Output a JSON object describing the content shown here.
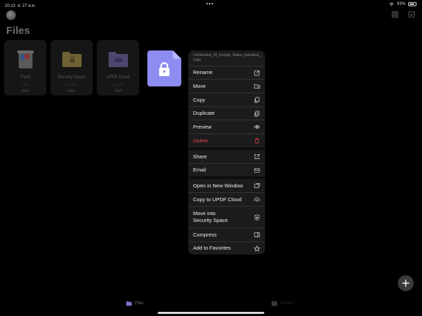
{
  "status_bar": {
    "time": "20:13",
    "date": "ส. 27 ส.ค.",
    "battery": "83%",
    "battery_level": 0.83
  },
  "page_title": "Files",
  "tiles": [
    {
      "name": "Trash",
      "sub": "1 Item",
      "badge": ""
    },
    {
      "name": "Security Space",
      "sub": "12 Items",
      "badge": ""
    },
    {
      "name": "UPDF Cloud",
      "sub": "0 Items",
      "badge": ""
    }
  ],
  "context_menu": {
    "file_name": "Certification_Of_Foreign_Status_Individual_Copy",
    "items": [
      {
        "label": "Rename",
        "icon": "rename-icon"
      },
      {
        "label": "Move",
        "icon": "folder-move-icon"
      },
      {
        "label": "Copy",
        "icon": "copy-icon"
      },
      {
        "label": "Duplicate",
        "icon": "duplicate-icon"
      },
      {
        "label": "Preview",
        "icon": "eye-icon"
      },
      {
        "label": "Delete",
        "icon": "trash-icon",
        "color": "#e0443e"
      },
      {
        "label": "Share",
        "icon": "share-icon"
      },
      {
        "label": "Email",
        "icon": "mail-icon"
      },
      {
        "label": "Open in New Window",
        "icon": "new-window-icon"
      },
      {
        "label": "Copy to UPDF Cloud",
        "icon": "cloud-upload-icon"
      },
      {
        "label": "Move into\nSecurity Space",
        "icon": "shield-lock-icon"
      },
      {
        "label": "Compress",
        "icon": "archive-icon"
      },
      {
        "label": "Add to Favorites",
        "icon": "star-icon"
      }
    ]
  },
  "tab_bar": {
    "files_label": "Files",
    "second_label": "Recent"
  },
  "colors": {
    "accent": "#7e6fc9",
    "pdf_icon": "#8d8cf0",
    "danger": "#e0443e"
  }
}
